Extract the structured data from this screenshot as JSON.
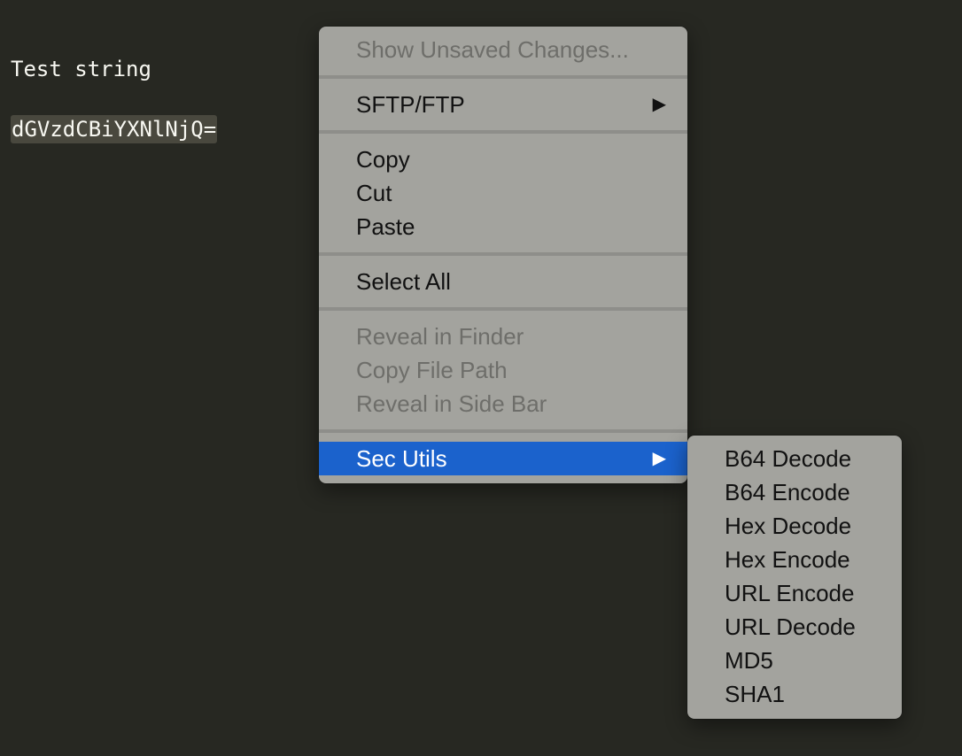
{
  "editor": {
    "lines": [
      "Test string",
      "dGVzdCBiYXNlNjQ="
    ]
  },
  "context_menu": {
    "items": [
      {
        "label": "Show Unsaved Changes...",
        "enabled": false
      },
      {
        "label": "SFTP/FTP",
        "enabled": true,
        "has_submenu": true
      },
      {
        "label": "Copy",
        "enabled": true
      },
      {
        "label": "Cut",
        "enabled": true
      },
      {
        "label": "Paste",
        "enabled": true
      },
      {
        "label": "Select All",
        "enabled": true
      },
      {
        "label": "Reveal in Finder",
        "enabled": false
      },
      {
        "label": "Copy File Path",
        "enabled": false
      },
      {
        "label": "Reveal in Side Bar",
        "enabled": false
      },
      {
        "label": "Sec Utils",
        "enabled": true,
        "has_submenu": true,
        "highlighted": true
      }
    ],
    "submenu_arrow": "▶"
  },
  "sec_utils_submenu": {
    "items": [
      {
        "label": "B64 Decode"
      },
      {
        "label": "B64 Encode"
      },
      {
        "label": "Hex Decode"
      },
      {
        "label": "Hex Encode"
      },
      {
        "label": "URL Encode"
      },
      {
        "label": "URL Decode"
      },
      {
        "label": "MD5"
      },
      {
        "label": "SHA1"
      }
    ]
  },
  "colors": {
    "editor_background": "#272822",
    "menu_background": "#a3a39e",
    "highlight": "#1b62cc"
  }
}
